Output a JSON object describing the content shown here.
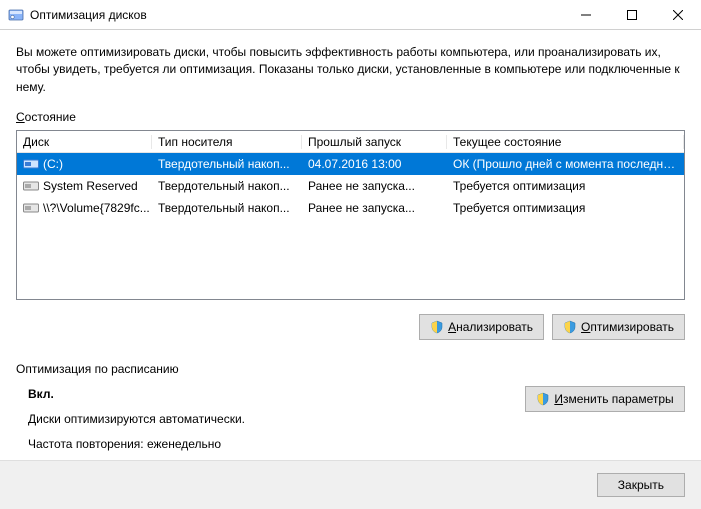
{
  "window": {
    "title": "Оптимизация дисков"
  },
  "intro": "Вы можете оптимизировать диски, чтобы повысить эффективность работы компьютера, или проанализировать их, чтобы увидеть, требуется ли оптимизация. Показаны только диски, установленные в компьютере или подключенные к нему.",
  "state_label_pre": "С",
  "state_label_rest": "остояние",
  "columns": {
    "disk": "Диск",
    "media": "Тип носителя",
    "last": "Прошлый запуск",
    "status": "Текущее состояние"
  },
  "rows": [
    {
      "disk": "(C:)",
      "media": "Твердотельный накоп...",
      "last": "04.07.2016 13:00",
      "status": "ОК (Прошло дней с момента последне...",
      "selected": true,
      "icon": "blue"
    },
    {
      "disk": "System Reserved",
      "media": "Твердотельный накоп...",
      "last": "Ранее не запуска...",
      "status": "Требуется оптимизация",
      "selected": false,
      "icon": "gray"
    },
    {
      "disk": "\\\\?\\Volume{7829fc...",
      "media": "Твердотельный накоп...",
      "last": "Ранее не запуска...",
      "status": "Требуется оптимизация",
      "selected": false,
      "icon": "gray"
    }
  ],
  "buttons": {
    "analyze_pre": "А",
    "analyze_rest": "нализировать",
    "optimize_pre": "О",
    "optimize_rest": "птимизировать",
    "change_pre": "И",
    "change_rest": "зменить параметры",
    "close": "Закрыть"
  },
  "schedule": {
    "label": "Оптимизация по расписанию",
    "on": "Вкл.",
    "auto": "Диски оптимизируются автоматически.",
    "freq": "Частота повторения: еженедельно"
  }
}
